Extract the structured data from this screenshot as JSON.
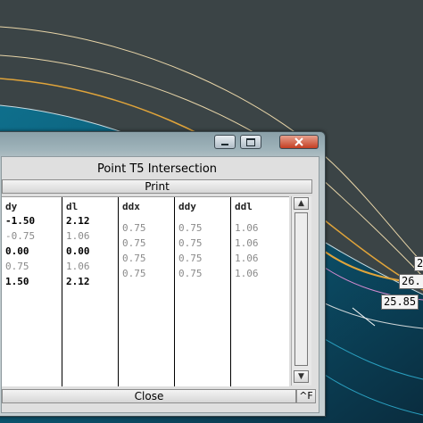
{
  "canvas": {
    "labels": [
      {
        "text": "2"
      },
      {
        "text": "26."
      },
      {
        "text": "25.85"
      }
    ]
  },
  "window": {
    "title": "Point T5 Intersection",
    "controls": {
      "minimize": "-",
      "maximize": "□",
      "close": "X"
    },
    "print_label": "Print",
    "close_label": "Close",
    "corner_label": "^F",
    "scroll_up": "▲",
    "scroll_down": "▼",
    "columns": [
      {
        "header": "dy",
        "values": [
          "-1.50",
          "-0.75",
          "0.00",
          "0.75",
          "1.50"
        ],
        "styles": [
          "b",
          "g",
          "b",
          "g",
          "b"
        ]
      },
      {
        "header": "dl",
        "values": [
          "2.12",
          "1.06",
          "0.00",
          "1.06",
          "2.12"
        ],
        "styles": [
          "b",
          "g",
          "b",
          "g",
          "b"
        ]
      },
      {
        "header": "ddx",
        "values": [
          "",
          "0.75",
          "0.75",
          "0.75",
          "0.75"
        ],
        "styles": [
          "g",
          "g",
          "g",
          "g",
          "g"
        ]
      },
      {
        "header": "ddy",
        "values": [
          "",
          "0.75",
          "0.75",
          "0.75",
          "0.75"
        ],
        "styles": [
          "g",
          "g",
          "g",
          "g",
          "g"
        ]
      },
      {
        "header": "ddl",
        "values": [
          "",
          "1.06",
          "1.06",
          "1.06",
          "1.06"
        ],
        "styles": [
          "g",
          "g",
          "g",
          "g",
          "g"
        ]
      }
    ]
  },
  "colors": {
    "background": "#3b4446",
    "surface_light": "#0e6f8c",
    "surface_dark": "#0a2c3e",
    "orange_line": "#e0a43a",
    "pale_line": "#e8d5a8"
  }
}
